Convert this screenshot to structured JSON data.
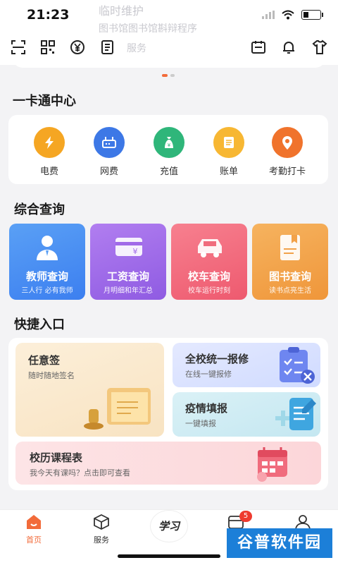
{
  "status": {
    "time": "21:23"
  },
  "banner": {
    "ghost_title": "临时维护",
    "ghost_subtitle": "图书馆图书馆斟辩程序",
    "ghost_extra": "服务"
  },
  "card_center": {
    "title": "一卡通中心",
    "items": [
      {
        "label": "电费",
        "icon": "lightning-icon",
        "color": "#f5a623"
      },
      {
        "label": "网费",
        "icon": "router-icon",
        "color": "#3d78e6"
      },
      {
        "label": "充值",
        "icon": "money-bag-icon",
        "color": "#2fb67a"
      },
      {
        "label": "账单",
        "icon": "bill-icon",
        "color": "#f7b733"
      },
      {
        "label": "考勤打卡",
        "icon": "location-pin-icon",
        "color": "#f0732c"
      }
    ]
  },
  "query": {
    "title": "综合查询",
    "cards": [
      {
        "title": "教师查询",
        "subtitle": "三人行 必有我师",
        "color": "#4a8df0",
        "icon": "teacher-icon"
      },
      {
        "title": "工资查询",
        "subtitle": "月明细和年汇总",
        "color": "#a06ae8",
        "icon": "salary-card-icon"
      },
      {
        "title": "校车查询",
        "subtitle": "校车运行时刻",
        "color": "#f06c7d",
        "icon": "bus-icon"
      },
      {
        "title": "图书查询",
        "subtitle": "读书点亮生活",
        "color": "#f2a24a",
        "icon": "book-icon"
      }
    ]
  },
  "quick": {
    "title": "快捷入口",
    "sign": {
      "title": "任意签",
      "subtitle": "随时随地签名"
    },
    "repair": {
      "title": "全校统一报修",
      "subtitle": "在线一键报修"
    },
    "epidemic": {
      "title": "疫情填报",
      "subtitle": "一键填报"
    },
    "calendar": {
      "title": "校历课程表",
      "subtitle": "我今天有课吗？点击即可查看"
    }
  },
  "tabs": [
    {
      "label": "首页",
      "icon": "home-icon"
    },
    {
      "label": "服务",
      "icon": "cube-icon"
    },
    {
      "label": "学习",
      "icon": "study-logo-icon"
    },
    {
      "label": "消息",
      "icon": "message-icon"
    },
    {
      "label": "我的",
      "icon": "user-icon"
    }
  ],
  "badge": {
    "count": "5"
  },
  "watermark": {
    "text": "谷普软件园"
  }
}
